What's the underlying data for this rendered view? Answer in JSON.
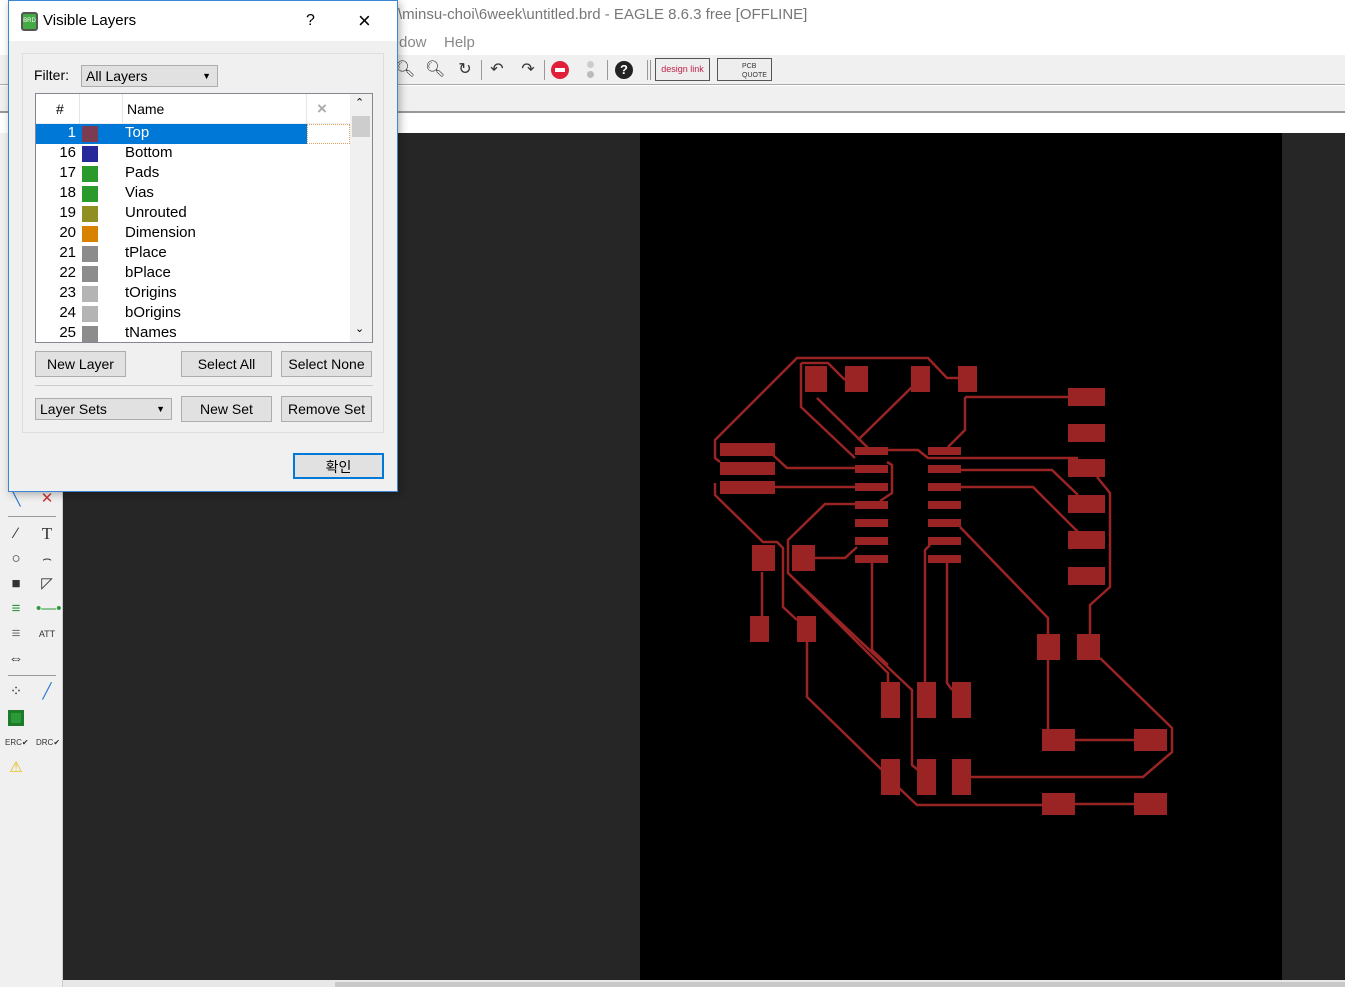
{
  "window": {
    "title": "\\minsu-choi\\6week\\untitled.brd - EAGLE 8.6.3 free [OFFLINE]",
    "menu": [
      "dow",
      "Help"
    ]
  },
  "toolbar": {
    "icons": [
      "zoom-out-icon",
      "zoom-select-icon",
      "redraw-icon",
      "undo-icon",
      "redo-icon",
      "stop-icon",
      "go-icon",
      "help-icon"
    ],
    "design_link": "design link",
    "pcb_quote": "PCB QUOTE"
  },
  "left_tools": [
    "route-icon",
    "ripup-icon",
    "wire-icon",
    "text-icon",
    "circle-icon",
    "arc-icon",
    "rect-icon",
    "polygon-icon",
    "via-icon",
    "signal-icon",
    "hole-icon",
    "attribute-icon",
    "dimension-icon",
    "ratsnest-icon",
    "autorouter-icon",
    "board-icon",
    "erc-icon",
    "drc-icon",
    "warning-icon"
  ],
  "dialog": {
    "title": "Visible Layers",
    "help": "?",
    "close": "×",
    "filter_label": "Filter:",
    "filter_value": "All Layers",
    "columns": {
      "num": "#",
      "color": "",
      "name": "Name",
      "x": "×"
    },
    "layers": [
      {
        "num": "1",
        "name": "Top",
        "color": "#7b3b50",
        "selected": true
      },
      {
        "num": "16",
        "name": "Bottom",
        "color": "#27299a"
      },
      {
        "num": "17",
        "name": "Pads",
        "color": "#2a9a2a"
      },
      {
        "num": "18",
        "name": "Vias",
        "color": "#2a9a2a"
      },
      {
        "num": "19",
        "name": "Unrouted",
        "color": "#8f8f22"
      },
      {
        "num": "20",
        "name": "Dimension",
        "color": "#d98200"
      },
      {
        "num": "21",
        "name": "tPlace",
        "color": "#8c8c8c"
      },
      {
        "num": "22",
        "name": "bPlace",
        "color": "#8c8c8c"
      },
      {
        "num": "23",
        "name": "tOrigins",
        "color": "#b4b4b4"
      },
      {
        "num": "24",
        "name": "bOrigins",
        "color": "#b4b4b4"
      },
      {
        "num": "25",
        "name": "tNames",
        "color": "#8c8c8c"
      }
    ],
    "new_layer": "New Layer",
    "select_all": "Select All",
    "select_none": "Select None",
    "layer_sets": "Layer Sets",
    "new_set": "New Set",
    "remove_set": "Remove Set",
    "ok": "확인"
  },
  "colors": {
    "trace": "#9a2424",
    "board": "#000000",
    "canvas": "#262626",
    "selection": "#0078d7"
  }
}
